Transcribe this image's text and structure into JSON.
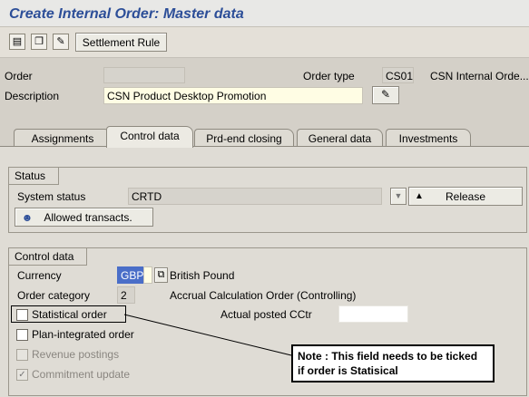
{
  "window": {
    "title": "Create Internal Order: Master data"
  },
  "toolbar": {
    "icons": [
      "display-icon",
      "copy-icon",
      "edit-icon"
    ],
    "settlement_rule_label": "Settlement Rule"
  },
  "header": {
    "order_label": "Order",
    "order_value": "",
    "order_type_label": "Order type",
    "order_type_value": "CS01",
    "order_type_desc": "CSN Internal Orde...",
    "description_label": "Description",
    "description_value": "CSN Product Desktop Promotion"
  },
  "tabs": [
    {
      "label": "Assignments",
      "active": false
    },
    {
      "label": "Control data",
      "active": true
    },
    {
      "label": "Prd-end closing",
      "active": false
    },
    {
      "label": "General data",
      "active": false
    },
    {
      "label": "Investments",
      "active": false
    }
  ],
  "status_group": {
    "title": "Status",
    "system_status_label": "System status",
    "system_status_value": "CRTD",
    "release_label": "Release",
    "allowed_transacts_label": "Allowed transacts."
  },
  "control_group": {
    "title": "Control data",
    "currency_label": "Currency",
    "currency_value": "GBP",
    "currency_desc": "British Pound",
    "order_category_label": "Order category",
    "order_category_value": "2",
    "order_category_desc": "Accrual Calculation Order (Controlling)",
    "statistical_order_label": "Statistical order",
    "statistical_order_checked": false,
    "actual_posted_cctr_label": "Actual posted CCtr",
    "actual_posted_cctr_value": "",
    "plan_integrated_label": "Plan-integrated order",
    "plan_integrated_checked": false,
    "revenue_postings_label": "Revenue postings",
    "revenue_postings_checked": false,
    "commitment_update_label": "Commitment update",
    "commitment_update_checked": true
  },
  "annotation": {
    "line1": "Note : This field needs to be ticked",
    "line2": "if order is Statisical"
  },
  "colors": {
    "title_text": "#2c4e98",
    "background": "#d4d0c8",
    "note_border": "#000000"
  }
}
